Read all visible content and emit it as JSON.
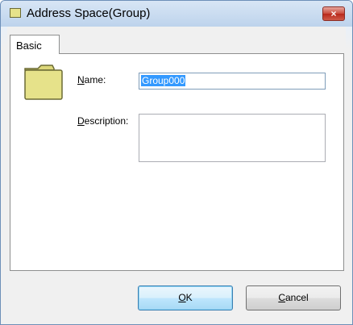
{
  "window": {
    "title": "Address Space(Group)",
    "close_label": "×"
  },
  "tabs": [
    {
      "label": "Basic",
      "selected": true
    }
  ],
  "form": {
    "name_label": "Name:",
    "name_mnemonic": "N",
    "name_rest": "ame:",
    "name_value": "Group000",
    "description_label": "Description:",
    "description_mnemonic": "D",
    "description_rest": "escription:",
    "description_value": ""
  },
  "buttons": {
    "ok_mnemonic": "O",
    "ok_rest": "K",
    "cancel_mnemonic": "C",
    "cancel_rest": "ancel"
  },
  "icons": {
    "title": "folder-icon",
    "group": "folder-icon",
    "close": "close-icon"
  },
  "colors": {
    "folder_fill": "#e6e28a",
    "folder_outline": "#6b6a35",
    "selection": "#3399ff",
    "close_button": "#c94a3c"
  }
}
